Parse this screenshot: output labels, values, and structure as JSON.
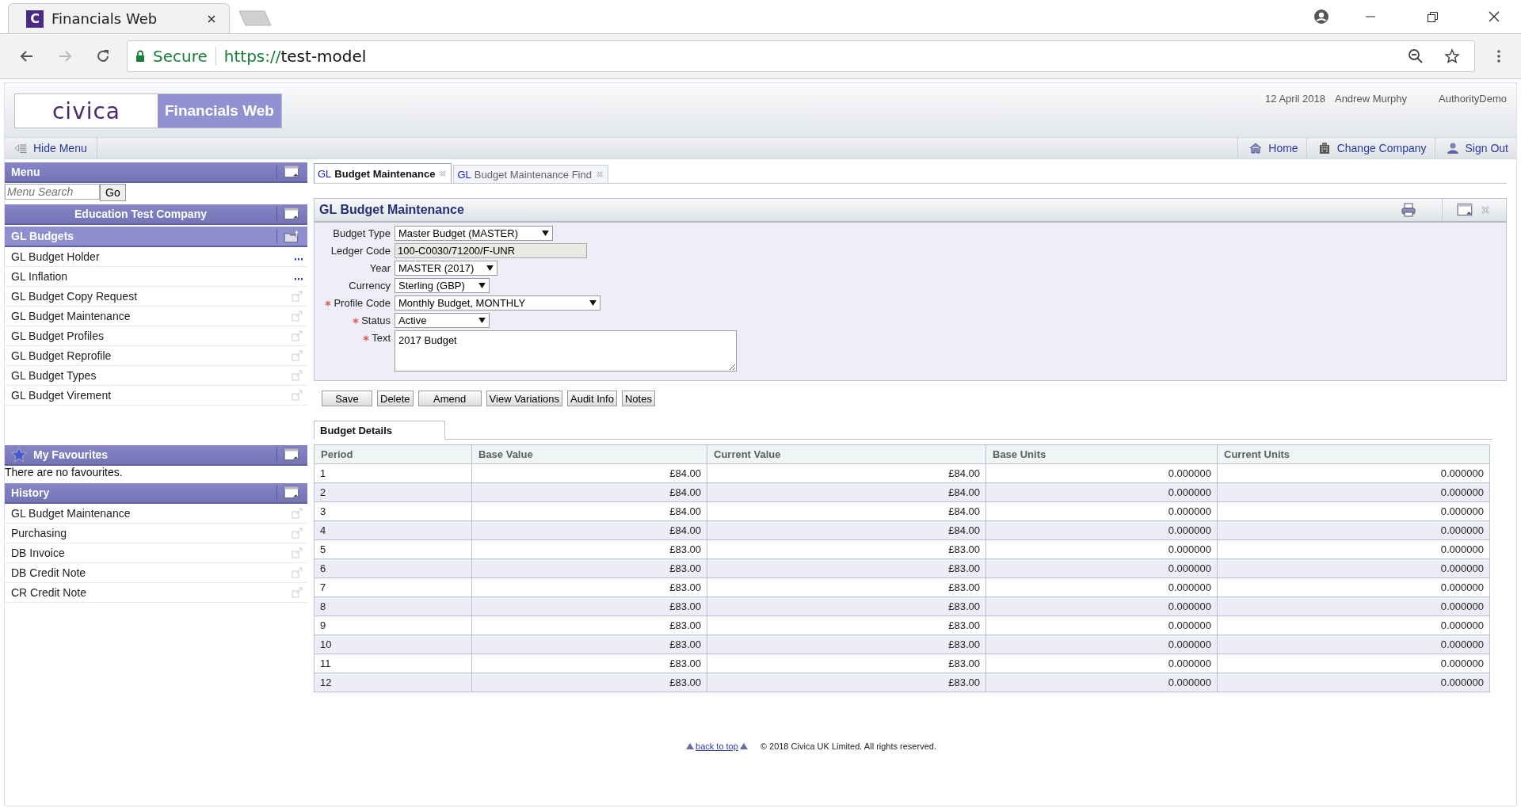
{
  "browser": {
    "tab_title": "Financials Web",
    "favicon": "C",
    "security": "Secure",
    "url_scheme": "https://",
    "url_host": "test-model"
  },
  "header": {
    "logo": "civica",
    "product": "Financials Web",
    "date": "12 April 2018",
    "user": "Andrew Murphy",
    "authority": "AuthorityDemo"
  },
  "nav": {
    "hide_menu": "Hide Menu",
    "links": [
      {
        "label": "Home",
        "kind": "home"
      },
      {
        "label": "Change Company",
        "kind": "company"
      },
      {
        "label": "Sign Out",
        "kind": "signout"
      }
    ]
  },
  "sidebar": {
    "menu_title": "Menu",
    "search": {
      "placeholder": "Menu Search",
      "button": "Go"
    },
    "company": "Education Test Company",
    "section": "GL Budgets",
    "items": [
      {
        "label": "GL Budget Holder",
        "kind": "dialog"
      },
      {
        "label": "GL Inflation",
        "kind": "dialog"
      },
      {
        "label": "GL Budget Copy Request",
        "kind": "page"
      },
      {
        "label": "GL Budget Maintenance",
        "kind": "page"
      },
      {
        "label": "GL Budget Profiles",
        "kind": "page"
      },
      {
        "label": "GL Budget Reprofile",
        "kind": "page"
      },
      {
        "label": "GL Budget Types",
        "kind": "page"
      },
      {
        "label": "GL Budget Virement",
        "kind": "page"
      }
    ],
    "favourites": {
      "title": "My Favourites",
      "empty": "There are no favourites."
    },
    "history": {
      "title": "History",
      "items": [
        {
          "label": "GL Budget Maintenance"
        },
        {
          "label": "Purchasing"
        },
        {
          "label": "DB Invoice"
        },
        {
          "label": "DB Credit Note"
        },
        {
          "label": "CR Credit Note"
        }
      ]
    }
  },
  "tabs": [
    {
      "prefix": "GL",
      "label": "Budget Maintenance",
      "selected": true
    },
    {
      "prefix": "GL",
      "label": "Budget Maintenance Find",
      "selected": false
    }
  ],
  "form": {
    "title": "GL Budget Maintenance",
    "fields": [
      {
        "label": "Budget Type",
        "required": false,
        "kind": "select",
        "value": "Master Budget (MASTER)"
      },
      {
        "label": "Ledger Code",
        "required": false,
        "kind": "readonly",
        "value": "100-C0030/71200/F-UNR"
      },
      {
        "label": "Year",
        "required": false,
        "kind": "select",
        "value": "MASTER (2017)"
      },
      {
        "label": "Currency",
        "required": false,
        "kind": "select",
        "value": "Sterling (GBP)"
      },
      {
        "label": "Profile Code",
        "required": true,
        "kind": "select",
        "value": "Monthly Budget, MONTHLY"
      },
      {
        "label": "Status",
        "required": true,
        "kind": "select",
        "value": "Active"
      },
      {
        "label": "Text",
        "required": true,
        "kind": "textarea",
        "value": "2017 Budget"
      }
    ]
  },
  "buttons": [
    "Save",
    "Delete",
    "Amend",
    "View Variations",
    "Audit Info",
    "Notes"
  ],
  "details_tab": {
    "label": "Budget Details",
    "selected": true
  },
  "table": {
    "columns": [
      "Period",
      "Base Value",
      "Current Value",
      "Base Units",
      "Current Units"
    ],
    "rows": [
      [
        "1",
        "£84.00",
        "£84.00",
        "0.000000",
        "0.000000"
      ],
      [
        "2",
        "£84.00",
        "£84.00",
        "0.000000",
        "0.000000"
      ],
      [
        "3",
        "£84.00",
        "£84.00",
        "0.000000",
        "0.000000"
      ],
      [
        "4",
        "£84.00",
        "£84.00",
        "0.000000",
        "0.000000"
      ],
      [
        "5",
        "£83.00",
        "£83.00",
        "0.000000",
        "0.000000"
      ],
      [
        "6",
        "£83.00",
        "£83.00",
        "0.000000",
        "0.000000"
      ],
      [
        "7",
        "£83.00",
        "£83.00",
        "0.000000",
        "0.000000"
      ],
      [
        "8",
        "£83.00",
        "£83.00",
        "0.000000",
        "0.000000"
      ],
      [
        "9",
        "£83.00",
        "£83.00",
        "0.000000",
        "0.000000"
      ],
      [
        "10",
        "£83.00",
        "£83.00",
        "0.000000",
        "0.000000"
      ],
      [
        "11",
        "£83.00",
        "£83.00",
        "0.000000",
        "0.000000"
      ],
      [
        "12",
        "£83.00",
        "£83.00",
        "0.000000",
        "0.000000"
      ]
    ]
  },
  "footer": {
    "back_to_top": "back to top",
    "copyright": "© 2018 Civica UK Limited. All rights reserved."
  }
}
